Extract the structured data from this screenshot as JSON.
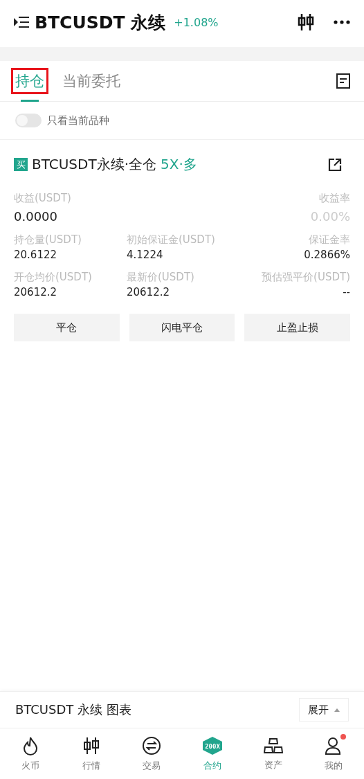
{
  "header": {
    "title": "BTCUSDT 永续",
    "change": "+1.08%"
  },
  "tabs": [
    {
      "label": "持仓",
      "selected": true,
      "highlighted": true
    },
    {
      "label": "当前委托",
      "selected": false,
      "highlighted": false
    }
  ],
  "filter": {
    "label": "只看当前品种",
    "on": false
  },
  "position": {
    "side_badge": "买",
    "name": "BTCUSDT永续·全仓",
    "leverage": "5X·多",
    "pnl": {
      "label": "收益(USDT)",
      "value": "0.0000"
    },
    "pnl_rate": {
      "label": "收益率",
      "value": "0.00%"
    },
    "fields": [
      {
        "label": "持仓量(USDT)",
        "value": "20.6122"
      },
      {
        "label": "初始保证金(USDT)",
        "value": "4.1224"
      },
      {
        "label": "保证金率",
        "value": "0.2866%"
      },
      {
        "label": "开仓均价(USDT)",
        "value": "20612.2"
      },
      {
        "label": "最新价(USDT)",
        "value": "20612.2"
      },
      {
        "label": "预估强平价(USDT)",
        "value": "--"
      }
    ],
    "buttons": [
      "平仓",
      "闪电平仓",
      "止盈止损"
    ]
  },
  "chart_bar": {
    "title": "BTCUSDT 永续 图表",
    "button": "展开"
  },
  "nav": [
    {
      "label": "火币",
      "kind": "flame",
      "selected": false,
      "dot": false
    },
    {
      "label": "行情",
      "kind": "candles",
      "selected": false,
      "dot": false
    },
    {
      "label": "交易",
      "kind": "swap",
      "selected": false,
      "dot": false
    },
    {
      "label": "合约",
      "kind": "badge",
      "icon_text": "200X",
      "selected": true,
      "dot": false
    },
    {
      "label": "资产",
      "kind": "blocks",
      "selected": false,
      "dot": false
    },
    {
      "label": "我的",
      "kind": "user",
      "selected": false,
      "dot": true
    }
  ]
}
